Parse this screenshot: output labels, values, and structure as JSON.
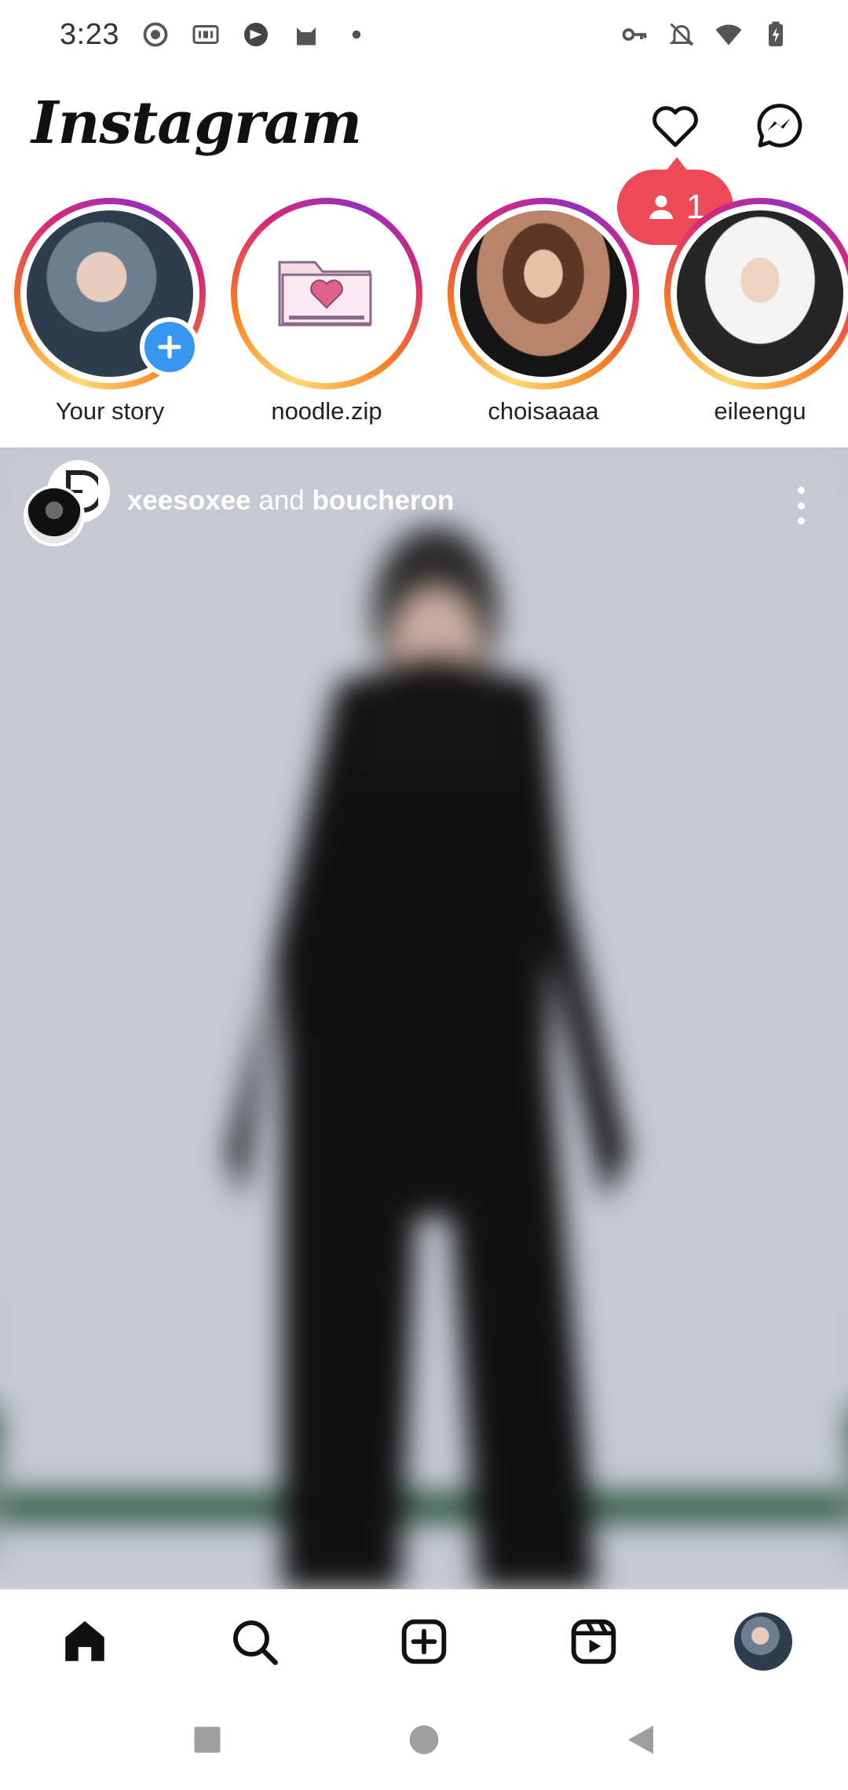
{
  "status_bar": {
    "time": "3:23",
    "left_icons": [
      "record-icon",
      "iqiyi-icon",
      "app-icon",
      "cat-icon",
      "dot-icon"
    ],
    "right_icons": [
      "vpn-key-icon",
      "mute-bell-icon",
      "wifi-icon",
      "battery-charging-icon"
    ]
  },
  "header": {
    "logo": "Instagram",
    "heart_icon": "heart-icon",
    "messenger_icon": "messenger-icon"
  },
  "notification": {
    "icon": "person-icon",
    "count": "1",
    "color": "#ed4956"
  },
  "stories": [
    {
      "name": "Your story",
      "has_add_badge": true
    },
    {
      "name": "noodle.zip"
    },
    {
      "name": "choisaaaa"
    },
    {
      "name": "eileengu"
    }
  ],
  "post": {
    "user1": "xeesoxee",
    "connector": " and ",
    "user2": "boucheron",
    "more_icon": "more-vertical-icon"
  },
  "bottom_nav": [
    "home-icon",
    "search-icon",
    "create-icon",
    "reels-icon",
    "profile-avatar"
  ],
  "system_nav": [
    "recents-button",
    "home-button",
    "back-button"
  ],
  "colors": {
    "story_ring": [
      "#feda75",
      "#fa7e1e",
      "#d62976",
      "#962fbf"
    ],
    "add_badge": "#3797f0"
  }
}
